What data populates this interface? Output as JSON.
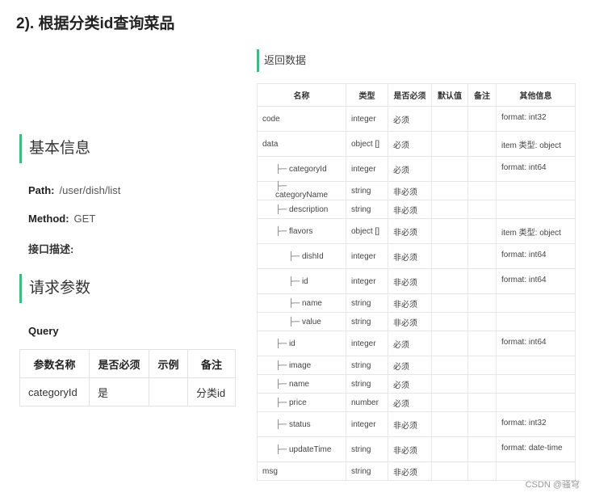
{
  "page_title": "2). 根据分类id查询菜品",
  "basic_info": {
    "heading": "基本信息",
    "path_label": "Path:",
    "path_value": "/user/dish/list",
    "method_label": "Method:",
    "method_value": "GET",
    "desc_label": "接口描述:"
  },
  "request_params": {
    "heading": "请求参数",
    "query_label": "Query",
    "headers": [
      "参数名称",
      "是否必须",
      "示例",
      "备注"
    ],
    "rows": [
      [
        "categoryId",
        "是",
        "",
        "分类id"
      ]
    ]
  },
  "return_data": {
    "heading": "返回数据",
    "headers": [
      "名称",
      "类型",
      "是否必须",
      "默认值",
      "备注",
      "其他信息"
    ],
    "rows": [
      {
        "prefix": "",
        "name": "code",
        "type": "integer",
        "required": "必须",
        "info": "format: int32"
      },
      {
        "prefix": "",
        "name": "data",
        "type": "object []",
        "required": "必须",
        "info": "item 类型: object"
      },
      {
        "prefix": "├─ ",
        "name": "categoryId",
        "type": "integer",
        "required": "必须",
        "info": "format: int64"
      },
      {
        "prefix": "├─ ",
        "name": "categoryName",
        "type": "string",
        "required": "非必须",
        "info": ""
      },
      {
        "prefix": "├─ ",
        "name": "description",
        "type": "string",
        "required": "非必须",
        "info": ""
      },
      {
        "prefix": "├─ ",
        "name": "flavors",
        "type": "object []",
        "required": "非必须",
        "info": "item 类型: object"
      },
      {
        "prefix": "├─ ",
        "name": "dishId",
        "type": "integer",
        "required": "非必须",
        "info": "format: int64"
      },
      {
        "prefix": "├─ ",
        "name": "id",
        "type": "integer",
        "required": "非必须",
        "info": "format: int64"
      },
      {
        "prefix": "├─ ",
        "name": "name",
        "type": "string",
        "required": "非必须",
        "info": ""
      },
      {
        "prefix": "├─ ",
        "name": "value",
        "type": "string",
        "required": "非必须",
        "info": ""
      },
      {
        "prefix": "├─ ",
        "name": "id",
        "type": "integer",
        "required": "必须",
        "info": "format: int64"
      },
      {
        "prefix": "├─ ",
        "name": "image",
        "type": "string",
        "required": "必须",
        "info": ""
      },
      {
        "prefix": "├─ ",
        "name": "name",
        "type": "string",
        "required": "必须",
        "info": ""
      },
      {
        "prefix": "├─ ",
        "name": "price",
        "type": "number",
        "required": "必须",
        "info": ""
      },
      {
        "prefix": "├─ ",
        "name": "status",
        "type": "integer",
        "required": "非必须",
        "info": "format: int32"
      },
      {
        "prefix": "├─ ",
        "name": "updateTime",
        "type": "string",
        "required": "非必须",
        "info": "format: date-time"
      },
      {
        "prefix": "",
        "name": "msg",
        "type": "string",
        "required": "非必须",
        "info": ""
      }
    ]
  },
  "watermark": "CSDN @骚穹"
}
